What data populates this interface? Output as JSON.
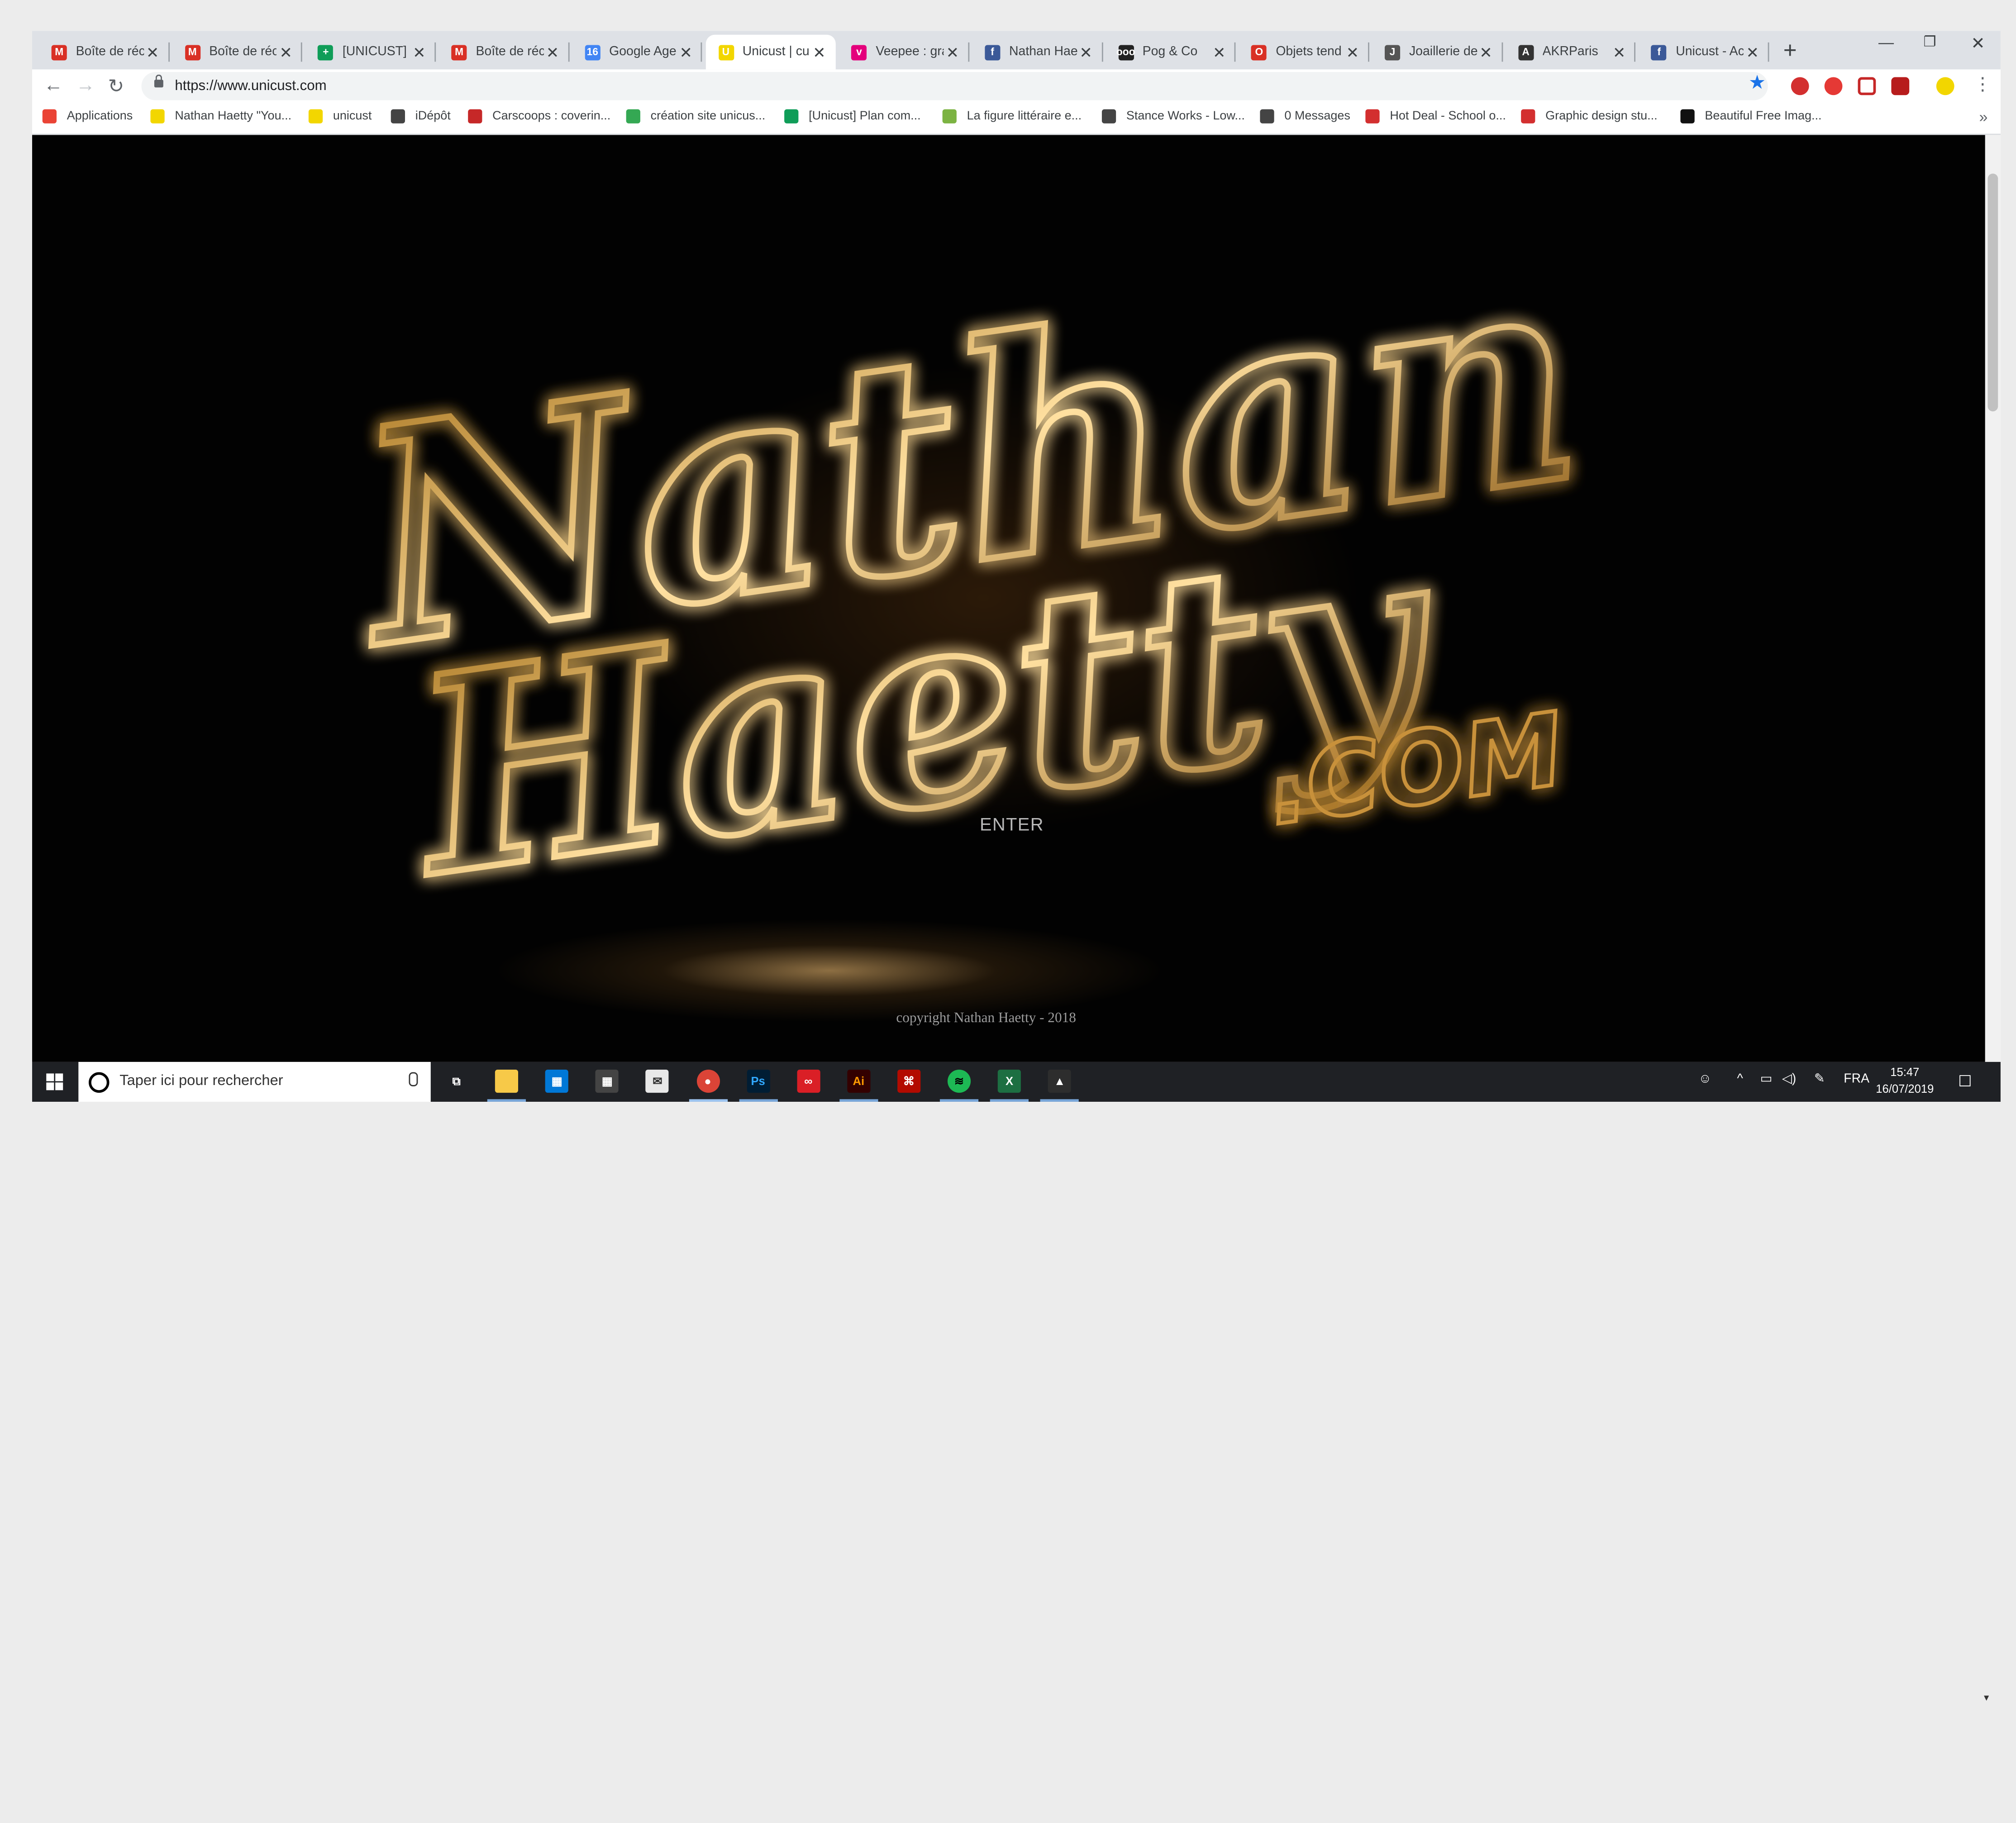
{
  "browser": {
    "tabs": [
      {
        "title": "Boîte de réc",
        "icon": "gmail-icon",
        "color": "#d93025",
        "glyph": "M"
      },
      {
        "title": "Boîte de réc",
        "icon": "gmail-icon",
        "color": "#d93025",
        "glyph": "M"
      },
      {
        "title": "[UNICUST] C",
        "icon": "sheets-icon",
        "color": "#0f9d58",
        "glyph": "+"
      },
      {
        "title": "Boîte de réc",
        "icon": "gmail-icon",
        "color": "#d93025",
        "glyph": "M"
      },
      {
        "title": "Google Age",
        "icon": "calendar-icon",
        "color": "#4285f4",
        "glyph": "16"
      },
      {
        "title": "Unicust | cu",
        "icon": "unicust-icon",
        "color": "#f2d600",
        "glyph": "U",
        "active": true
      },
      {
        "title": "Veepee : gra",
        "icon": "veepee-icon",
        "color": "#e4007c",
        "glyph": "v"
      },
      {
        "title": "Nathan Hae",
        "icon": "facebook-icon",
        "color": "#3b5998",
        "glyph": "f"
      },
      {
        "title": "Pog & Co",
        "icon": "pog-icon",
        "color": "#222222",
        "glyph": "ooo"
      },
      {
        "title": "Objets tend",
        "icon": "objets-icon",
        "color": "#d93025",
        "glyph": "O"
      },
      {
        "title": "Joaillerie de",
        "icon": "jewel-icon",
        "color": "#555555",
        "glyph": "J"
      },
      {
        "title": "AKRParis",
        "icon": "akr-icon",
        "color": "#333333",
        "glyph": "A"
      },
      {
        "title": "Unicust - Ac",
        "icon": "facebook-icon",
        "color": "#3b5998",
        "glyph": "f"
      }
    ],
    "new_tab": "+",
    "url": "https://www.unicust.com",
    "bookmarks": [
      {
        "label": "Applications",
        "color": "#ea4335"
      },
      {
        "label": "Nathan Haetty \"You...",
        "color": "#f2d600"
      },
      {
        "label": "unicust",
        "color": "#f2d600"
      },
      {
        "label": "iDépôt",
        "color": "#444444"
      },
      {
        "label": "Carscoops : coverin...",
        "color": "#c62828"
      },
      {
        "label": "création site unicus...",
        "color": "#34a853"
      },
      {
        "label": "[Unicust] Plan com...",
        "color": "#0f9d58"
      },
      {
        "label": "La figure littéraire e...",
        "color": "#7cb342"
      },
      {
        "label": "Stance Works - Low...",
        "color": "#444444"
      },
      {
        "label": "0 Messages",
        "color": "#444444"
      },
      {
        "label": "Hot Deal - School o...",
        "color": "#d32f2f"
      },
      {
        "label": "Graphic design stu...",
        "color": "#d32f2f"
      },
      {
        "label": "Beautiful Free Imag...",
        "color": "#111111"
      }
    ],
    "bookmarks_more": "»"
  },
  "page": {
    "logo_text_line1": "Nathan",
    "logo_text_line2": "Haetty",
    "logo_text_suffix": ".COM",
    "enter_label": "ENTER",
    "copyright": "copyright Nathan Haetty - 2018"
  },
  "taskbar": {
    "search_placeholder": "Taper ici pour rechercher",
    "apps": [
      "task-view-icon",
      "file-explorer-icon",
      "store-icon",
      "calculator-icon",
      "mail-icon",
      "chrome-icon",
      "photoshop-icon",
      "creative-cloud-icon",
      "illustrator-icon",
      "acrobat-icon",
      "spotify-icon",
      "excel-icon",
      "photos-icon"
    ],
    "language": "FRA",
    "time": "15:47",
    "date": "16/07/2019"
  }
}
